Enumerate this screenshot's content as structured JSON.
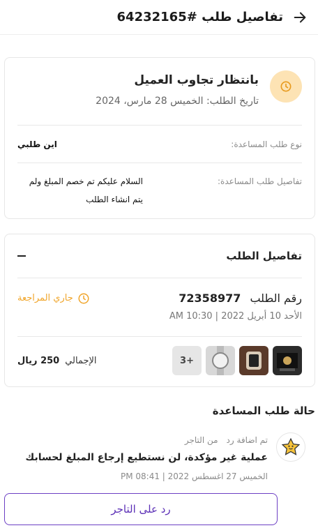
{
  "header": {
    "title": "تفاصيل طلب #64232165",
    "back_icon": "arrow-right-icon"
  },
  "status_card": {
    "icon": "clock-icon",
    "title": "بانتظار تجاوب العميل",
    "date": "تاريخ الطلب: الخميس 28 مارس، 2024",
    "type_label": "نوع طلب المساعدة:",
    "type_value": "اين طلبي",
    "details_label": "تفاصيل طلب المساعدة:",
    "details_value": "السلام عليكم تم خصم المبلغ ولم يتم انشاء الطلب"
  },
  "order_card": {
    "title": "تفاصيل الطلب",
    "collapse_icon": "minus-icon",
    "order_label": "رقم الطلب",
    "order_number": "72358977",
    "review_status": "جاري المراجعة",
    "order_date": "الأحد 10 أبريل 2022 | 10:30 AM",
    "more_count": "+3",
    "total_label": "الإجمالي",
    "total_value": "250 ريال",
    "colors": {
      "review": "#f0a52a"
    }
  },
  "help_status": {
    "title": "حالة طلب المساعدة",
    "reply_meta_added": "تم اضافة رد",
    "reply_meta_from": "من التاجر",
    "reply_message": "عملية غير مؤكدة، لن نستطيع إرجاع المبلغ لحسابك",
    "reply_date": "الخميس 27 اغسطس 2022 | 08:41 PM"
  },
  "reply_button": {
    "label": "رد على التاجر",
    "color": "#5b2fb6"
  }
}
